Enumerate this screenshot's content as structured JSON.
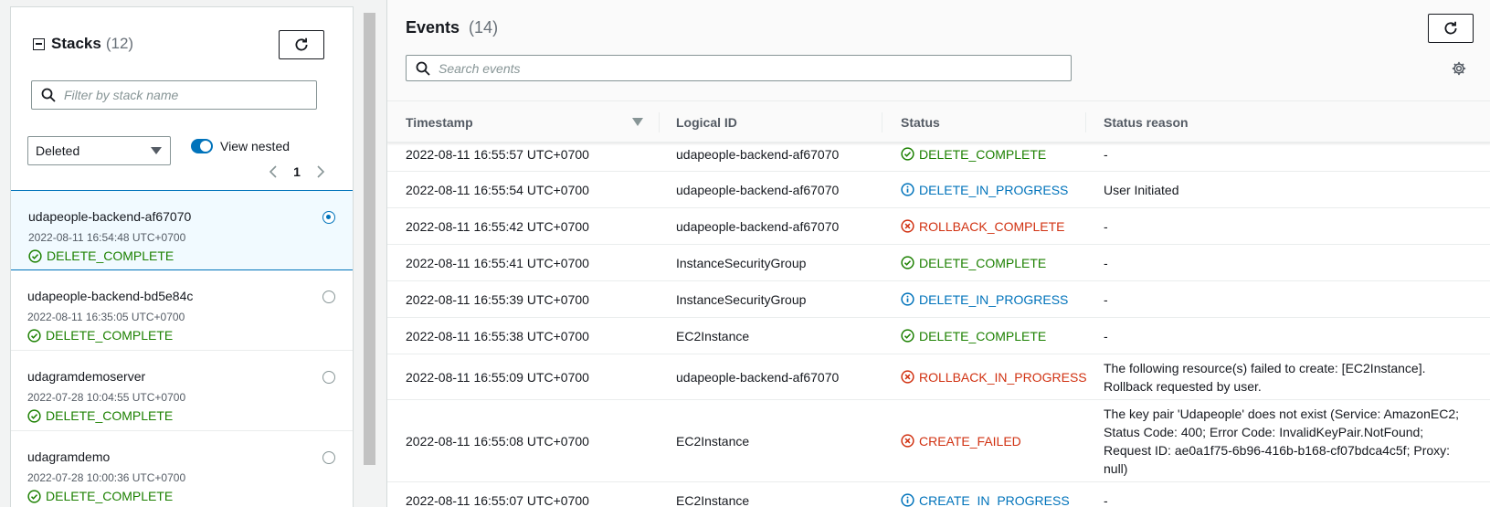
{
  "stacks_panel": {
    "title": "Stacks",
    "count": "(12)",
    "filter_placeholder": "Filter by stack name",
    "status_filter": "Deleted",
    "view_nested_label": "View nested",
    "view_nested_on": true,
    "page": "1",
    "items": [
      {
        "name": "udapeople-backend-af67070",
        "time": "2022-08-11 16:54:48 UTC+0700",
        "status": "DELETE_COMPLETE",
        "selected": true
      },
      {
        "name": "udapeople-backend-bd5e84c",
        "time": "2022-08-11 16:35:05 UTC+0700",
        "status": "DELETE_COMPLETE",
        "selected": false
      },
      {
        "name": "udagramdemoserver",
        "time": "2022-07-28 10:04:55 UTC+0700",
        "status": "DELETE_COMPLETE",
        "selected": false
      },
      {
        "name": "udagramdemo",
        "time": "2022-07-28 10:00:36 UTC+0700",
        "status": "DELETE_COMPLETE",
        "selected": false
      }
    ]
  },
  "events_panel": {
    "title": "Events",
    "count": "(14)",
    "search_placeholder": "Search events",
    "columns": [
      "Timestamp",
      "Logical ID",
      "Status",
      "Status reason"
    ],
    "rows": [
      {
        "timestamp": "2022-08-11 16:55:57 UTC+0700",
        "logical_id": "udapeople-backend-af67070",
        "status": "DELETE_COMPLETE",
        "kind": "green",
        "reason": "-"
      },
      {
        "timestamp": "2022-08-11 16:55:54 UTC+0700",
        "logical_id": "udapeople-backend-af67070",
        "status": "DELETE_IN_PROGRESS",
        "kind": "blue",
        "reason": "User Initiated"
      },
      {
        "timestamp": "2022-08-11 16:55:42 UTC+0700",
        "logical_id": "udapeople-backend-af67070",
        "status": "ROLLBACK_COMPLETE",
        "kind": "red",
        "reason": "-"
      },
      {
        "timestamp": "2022-08-11 16:55:41 UTC+0700",
        "logical_id": "InstanceSecurityGroup",
        "status": "DELETE_COMPLETE",
        "kind": "green",
        "reason": "-"
      },
      {
        "timestamp": "2022-08-11 16:55:39 UTC+0700",
        "logical_id": "InstanceSecurityGroup",
        "status": "DELETE_IN_PROGRESS",
        "kind": "blue",
        "reason": "-"
      },
      {
        "timestamp": "2022-08-11 16:55:38 UTC+0700",
        "logical_id": "EC2Instance",
        "status": "DELETE_COMPLETE",
        "kind": "green",
        "reason": "-"
      },
      {
        "timestamp": "2022-08-11 16:55:09 UTC+0700",
        "logical_id": "udapeople-backend-af67070",
        "status": "ROLLBACK_IN_PROGRESS",
        "kind": "red",
        "reason": "The following resource(s) failed to create: [EC2Instance]. Rollback requested by user."
      },
      {
        "timestamp": "2022-08-11 16:55:08 UTC+0700",
        "logical_id": "EC2Instance",
        "status": "CREATE_FAILED",
        "kind": "red",
        "reason": "The key pair 'Udapeople' does not exist (Service: AmazonEC2; Status Code: 400; Error Code: InvalidKeyPair.NotFound; Request ID: ae0a1f75-6b96-416b-b168-cf07bdca4c5f; Proxy: null)"
      },
      {
        "timestamp": "2022-08-11 16:55:07 UTC+0700",
        "logical_id": "EC2Instance",
        "status": "CREATE_IN_PROGRESS",
        "kind": "blue",
        "reason": "-"
      }
    ]
  },
  "colors": {
    "success": "#1d8102",
    "info": "#0073bb",
    "error": "#d13212"
  }
}
